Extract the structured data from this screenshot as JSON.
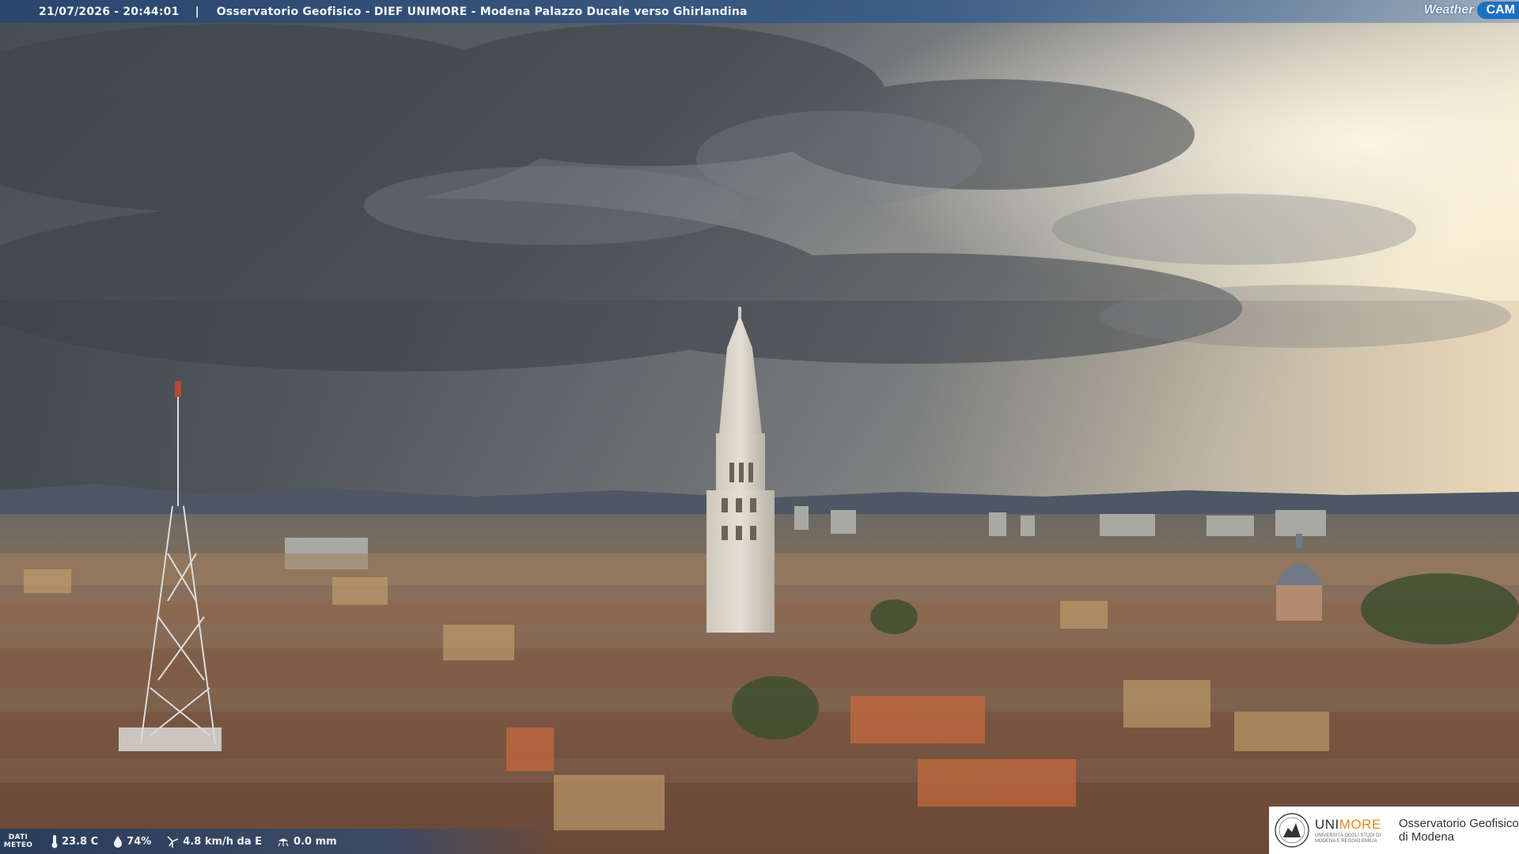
{
  "header": {
    "timestamp": "21/07/2026 - 20:44:01",
    "separator": "|",
    "caption": "Osservatorio Geofisico - DIEF UNIMORE - Modena Palazzo Ducale verso Ghirlandina",
    "brand_weather": "Weather",
    "brand_cam": "CAM"
  },
  "weather": {
    "label_line1": "DATI",
    "label_line2": "METEO",
    "temperature": "23.8 C",
    "humidity": "74%",
    "wind": "4.8 km/h da E",
    "rain": "0.0 mm"
  },
  "logo": {
    "university_prefix": "UNI",
    "university_suffix": "MORE",
    "university_sub": "UNIVERSITÀ DEGLI STUDI DI MODENA E REGGIO EMILIA",
    "observatory_line1": "Osservatorio Geofisico",
    "observatory_line2": "di Modena"
  },
  "colors": {
    "sky_dark": "#4d535b",
    "sky_light": "#f4e9cf",
    "roofs": "#8a6b55",
    "tower": "#dcd6cc",
    "bar_blue": "#2f557f",
    "unimore_orange": "#e08a1e"
  }
}
